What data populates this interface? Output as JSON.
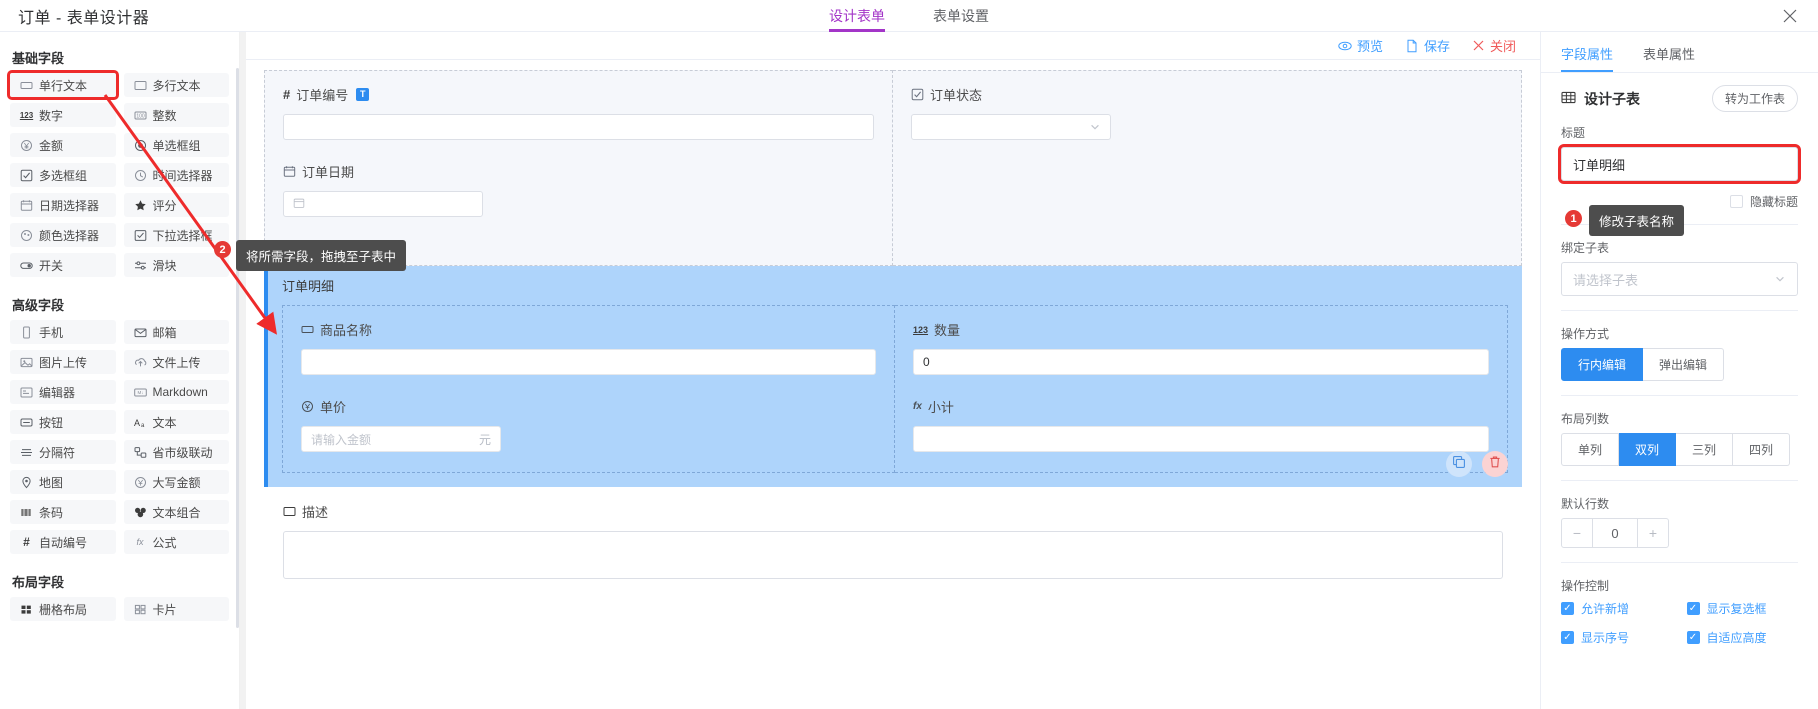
{
  "topbar": {
    "title": "订单 - 表单设计器",
    "tabs": [
      {
        "label": "设计表单",
        "active": true
      },
      {
        "label": "表单设置",
        "active": false
      }
    ],
    "close_icon": "close-icon"
  },
  "palette": {
    "groups": [
      {
        "title": "基础字段",
        "items": [
          {
            "label": "单行文本",
            "icon": "single-line-text-icon",
            "selected": true
          },
          {
            "label": "多行文本",
            "icon": "multi-line-text-icon"
          },
          {
            "label": "数字",
            "icon": "number-123-icon"
          },
          {
            "label": "整数",
            "icon": "integer-icon"
          },
          {
            "label": "金额",
            "icon": "currency-yuan-icon"
          },
          {
            "label": "单选框组",
            "icon": "radio-group-icon"
          },
          {
            "label": "多选框组",
            "icon": "checkbox-group-icon"
          },
          {
            "label": "时间选择器",
            "icon": "time-picker-icon"
          },
          {
            "label": "日期选择器",
            "icon": "date-picker-icon"
          },
          {
            "label": "评分",
            "icon": "star-rate-icon"
          },
          {
            "label": "颜色选择器",
            "icon": "color-picker-icon"
          },
          {
            "label": "下拉选择框",
            "icon": "select-dropdown-icon"
          },
          {
            "label": "开关",
            "icon": "switch-icon"
          },
          {
            "label": "滑块",
            "icon": "slider-icon"
          }
        ]
      },
      {
        "title": "高级字段",
        "items": [
          {
            "label": "手机",
            "icon": "phone-icon"
          },
          {
            "label": "邮箱",
            "icon": "mail-icon"
          },
          {
            "label": "图片上传",
            "icon": "image-upload-icon"
          },
          {
            "label": "文件上传",
            "icon": "file-upload-icon"
          },
          {
            "label": "编辑器",
            "icon": "rich-editor-icon"
          },
          {
            "label": "Markdown",
            "icon": "markdown-icon"
          },
          {
            "label": "按钮",
            "icon": "button-icon"
          },
          {
            "label": "文本",
            "icon": "text-aa-icon"
          },
          {
            "label": "分隔符",
            "icon": "divider-icon"
          },
          {
            "label": "省市级联动",
            "icon": "cascader-region-icon"
          },
          {
            "label": "地图",
            "icon": "map-pin-icon"
          },
          {
            "label": "大写金额",
            "icon": "capital-amount-icon"
          },
          {
            "label": "条码",
            "icon": "barcode-icon"
          },
          {
            "label": "文本组合",
            "icon": "text-combo-icon"
          },
          {
            "label": "自动编号",
            "icon": "auto-number-hash-icon"
          },
          {
            "label": "公式",
            "icon": "formula-fx-icon"
          }
        ]
      },
      {
        "title": "布局字段",
        "items": [
          {
            "label": "栅格布局",
            "icon": "grid-layout-icon"
          },
          {
            "label": "卡片",
            "icon": "card-layout-icon"
          }
        ]
      }
    ]
  },
  "canvas": {
    "toolbar": [
      {
        "label": "预览",
        "icon": "eye-icon",
        "kind": "link"
      },
      {
        "label": "保存",
        "icon": "save-file-icon",
        "kind": "link"
      },
      {
        "label": "关闭",
        "icon": "close-x-icon",
        "kind": "danger"
      }
    ],
    "fields": {
      "order_no": {
        "label": "订单编号",
        "icon": "auto-number-hash-icon",
        "badge": "T",
        "value": "",
        "placeholder": ""
      },
      "order_status": {
        "label": "订单状态",
        "icon": "checkbox-group-icon",
        "value": "",
        "placeholder": ""
      },
      "order_date": {
        "label": "订单日期",
        "icon": "date-picker-icon",
        "value": "",
        "placeholder": ""
      }
    },
    "subtable": {
      "title": "订单明细",
      "fields": {
        "product_name": {
          "label": "商品名称",
          "icon": "single-line-text-icon",
          "value": "",
          "placeholder": ""
        },
        "quantity": {
          "label": "数量",
          "icon": "number-123-icon",
          "value": "0",
          "placeholder": ""
        },
        "unit_price": {
          "label": "单价",
          "icon": "currency-yuan-icon",
          "value": "",
          "placeholder": "请输入金额",
          "suffix": "元"
        },
        "subtotal": {
          "label": "小计",
          "icon": "formula-fx-icon",
          "value": "",
          "placeholder": ""
        }
      },
      "actions": [
        {
          "name": "copy-row-button",
          "icon": "copy-icon"
        },
        {
          "name": "delete-row-button",
          "icon": "trash-icon"
        }
      ]
    },
    "description": {
      "label": "描述",
      "icon": "multi-line-text-icon",
      "value": "",
      "placeholder": ""
    }
  },
  "rightpanel": {
    "tabs": [
      {
        "label": "字段属性",
        "active": true
      },
      {
        "label": "表单属性",
        "active": false
      }
    ],
    "header": {
      "title": "设计子表",
      "icon": "table-icon",
      "action_label": "转为工作表"
    },
    "title_field": {
      "label": "标题",
      "value": "订单明细"
    },
    "hide_title": {
      "label": "隐藏标题",
      "checked": false
    },
    "bind_subtable": {
      "label": "绑定子表",
      "placeholder": "请选择子表",
      "value": ""
    },
    "operation_mode": {
      "label": "操作方式",
      "options": [
        {
          "label": "行内编辑",
          "active": true
        },
        {
          "label": "弹出编辑",
          "active": false
        }
      ]
    },
    "layout_columns": {
      "label": "布局列数",
      "options": [
        {
          "label": "单列",
          "active": false
        },
        {
          "label": "双列",
          "active": true
        },
        {
          "label": "三列",
          "active": false
        },
        {
          "label": "四列",
          "active": false
        }
      ]
    },
    "default_rows": {
      "label": "默认行数",
      "value": "0",
      "minus": "−",
      "plus": "+"
    },
    "operation_control": {
      "label": "操作控制",
      "items": [
        {
          "label": "允许新增",
          "checked": true
        },
        {
          "label": "显示复选框",
          "checked": true
        },
        {
          "label": "显示序号",
          "checked": true
        },
        {
          "label": "自适应高度",
          "checked": true
        }
      ]
    }
  },
  "annotations": [
    {
      "badge": "1",
      "text": "修改子表名称"
    },
    {
      "badge": "2",
      "text": "将所需字段，拖拽至子表中"
    }
  ],
  "colors": {
    "accent_purple": "#a335c8",
    "accent_blue": "#409eff",
    "danger_red": "#f05b5b",
    "annotation_red": "#e53935",
    "subtable_bg": "#aed4fb"
  }
}
